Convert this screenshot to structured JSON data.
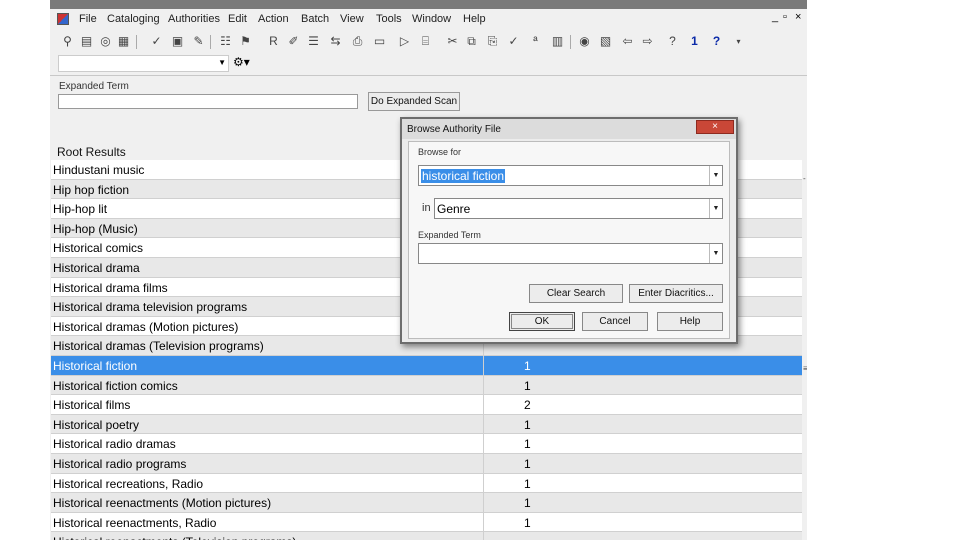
{
  "menu": {
    "items": [
      "File",
      "Cataloging",
      "Authorities",
      "Edit",
      "Action",
      "Batch",
      "View",
      "Tools",
      "Window",
      "Help"
    ],
    "window_controls": [
      "_",
      "▫",
      "×"
    ]
  },
  "expanded_term": {
    "label": "Expanded Term",
    "value": "",
    "scan_button": "Do Expanded Scan"
  },
  "results": {
    "label": "Root Results",
    "rows": [
      {
        "term": "Hindustani music",
        "count": ""
      },
      {
        "term": "Hip hop fiction",
        "count": ""
      },
      {
        "term": "Hip-hop lit",
        "count": ""
      },
      {
        "term": "Hip-hop (Music)",
        "count": ""
      },
      {
        "term": "Historical comics",
        "count": ""
      },
      {
        "term": "Historical drama",
        "count": ""
      },
      {
        "term": "Historical drama films",
        "count": ""
      },
      {
        "term": "Historical drama television programs",
        "count": ""
      },
      {
        "term": "Historical dramas (Motion pictures)",
        "count": ""
      },
      {
        "term": "Historical dramas (Television programs)",
        "count": ""
      },
      {
        "term": "Historical fiction",
        "count": "1"
      },
      {
        "term": "Historical fiction comics",
        "count": "1"
      },
      {
        "term": "Historical films",
        "count": "2"
      },
      {
        "term": "Historical poetry",
        "count": "1"
      },
      {
        "term": "Historical radio dramas",
        "count": "1"
      },
      {
        "term": "Historical radio programs",
        "count": "1"
      },
      {
        "term": "Historical recreations, Radio",
        "count": "1"
      },
      {
        "term": "Historical reenactments (Motion pictures)",
        "count": "1"
      },
      {
        "term": "Historical reenactments, Radio",
        "count": "1"
      },
      {
        "term": "Historical reenactments (Television programs)",
        "count": ""
      }
    ]
  },
  "dialog": {
    "title": "Browse Authority File",
    "close": "×",
    "browse_for_label": "Browse for",
    "browse_for_value": "historical fiction",
    "in_label": "in",
    "in_value": "Genre",
    "expanded_term_label": "Expanded Term",
    "expanded_term_value": "",
    "buttons": {
      "clear_search": "Clear Search",
      "enter_diacritics": "Enter Diacritics...",
      "ok": "OK",
      "cancel": "Cancel",
      "help": "Help"
    }
  },
  "toolbar": {
    "icons": [
      "lookup-icon",
      "browse-icon",
      "binoculars-icon",
      "authority-icon",
      "validate-icon",
      "control-headings-icon",
      "edit-icon",
      "report-icon",
      "reformat-icon",
      "insert-icon",
      "text-icon",
      "list-icon",
      "export-icon",
      "print-icon",
      "cut-icon",
      "copy-icon",
      "paste-icon",
      "spell-icon",
      "abc-icon",
      "constant-data-icon",
      "record-icon",
      "book-icon",
      "send-icon",
      "flag-icon"
    ],
    "help_label": "1",
    "help_q": "?"
  }
}
